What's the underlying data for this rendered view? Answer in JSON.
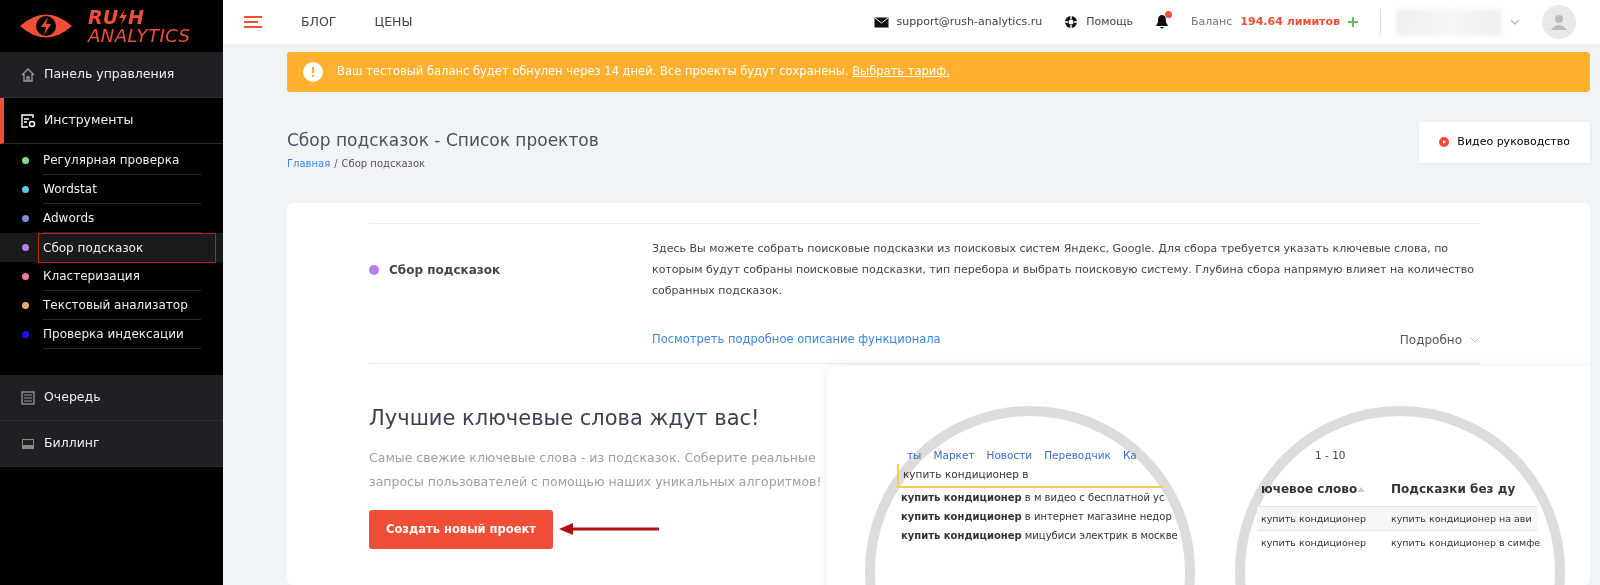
{
  "logo": {
    "top_left": "RU",
    "top_right": "H",
    "bottom": "ANALYTICS"
  },
  "sidebar": {
    "items": [
      {
        "label": "Панель управления",
        "kind": "home",
        "selected": false
      },
      {
        "label": "Инструменты",
        "kind": "tools",
        "selected": true,
        "expanded": true,
        "children": [
          {
            "label": "Регулярная проверка",
            "color": "#7ee07e",
            "selected": false
          },
          {
            "label": "Wordstat",
            "color": "#5bc8ee",
            "selected": false
          },
          {
            "label": "Adwords",
            "color": "#7b8fe0",
            "selected": false
          },
          {
            "label": "Сбор подсказок",
            "color": "#b77ee8",
            "selected": true
          },
          {
            "label": "Кластеризация",
            "color": "#f07bab",
            "selected": false
          },
          {
            "label": "Текстовый анализатор",
            "color": "#f5a66a",
            "selected": false
          },
          {
            "label": "Проверка индексации",
            "color": "#1414e8",
            "selected": false
          }
        ]
      },
      {
        "label": "Очередь",
        "kind": "queue",
        "selected": false
      },
      {
        "label": "Биллинг",
        "kind": "billing",
        "selected": false
      }
    ]
  },
  "topbar": {
    "links": [
      "БЛОГ",
      "ЦЕНЫ"
    ],
    "email": "support@rush-analytics.ru",
    "help": "Помощь",
    "notifications_unread": true,
    "balance_label": "Баланс",
    "balance_value": "194.64 лимитов"
  },
  "alert": {
    "text": "Ваш тестовый баланс будет обнулен через 14 дней. Все проекты будут сохранены.",
    "link": "Выбрать тариф."
  },
  "page": {
    "title": "Сбор подсказок - Список проектов",
    "breadcrumb": [
      "Главная",
      "Сбор подсказок"
    ],
    "breadcrumb_separator": "/",
    "video_button": "Видео руководство"
  },
  "info": {
    "title": "Сбор подсказок",
    "color": "#b77ee8",
    "description": "Здесь Вы можете собрать поисковые подсказки из поисковых систем Яндекс, Google. Для сбора требуется указать ключевые слова, по которым будут собраны поисковые подсказки, тип перебора и выбрать поисковую систему. Глубина сбора напрямую влияет на количество собранных подсказок.",
    "link": "Посмотреть подробное описание функционала",
    "more": "Подробно",
    "expanded": false
  },
  "promo": {
    "heading": "Лучшие ключевые слова ждут вас!",
    "text": "Самые свежие ключевые слова - из подсказок. Соберите реальные запросы пользователей с помощью наших уникальных алгоритмов!",
    "button": "Создать новый проект"
  },
  "illustration": {
    "search": {
      "tabs": [
        "ты",
        "Маркет",
        "Новости",
        "Переводчик",
        "Ка"
      ],
      "query": "купить кондиционер в",
      "suggestions": [
        "**купить кондиционер** в м видео с бесплатной ус",
        "**купить кондиционер** в интернет магазине недор",
        "**купить кондиционер** мицубиси электрик в москве"
      ]
    },
    "table": {
      "range": "1 - 10",
      "columns": [
        "ючевое слово",
        "Подсказки без ду"
      ],
      "rows": [
        [
          "купить кондиционер",
          "купить кондиционер на ави"
        ],
        [
          "купить кондиционер",
          "купить кондиционер в симфе"
        ]
      ]
    }
  }
}
